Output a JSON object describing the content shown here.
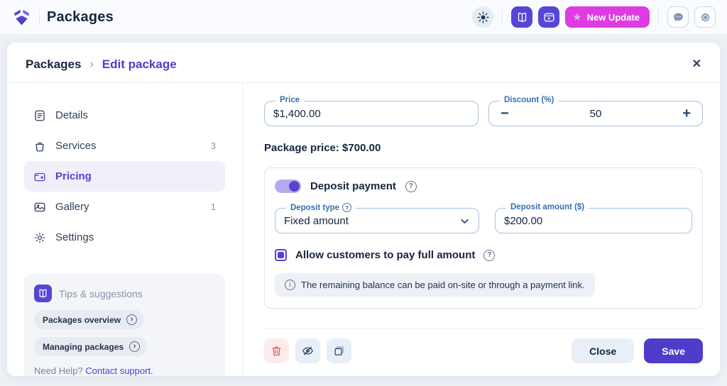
{
  "topbar": {
    "title": "Packages",
    "new_update": "New Update"
  },
  "breadcrumb": {
    "root": "Packages",
    "current": "Edit package"
  },
  "sidebar": {
    "items": [
      {
        "label": "Details",
        "badge": ""
      },
      {
        "label": "Services",
        "badge": "3"
      },
      {
        "label": "Pricing",
        "badge": ""
      },
      {
        "label": "Gallery",
        "badge": "1"
      },
      {
        "label": "Settings",
        "badge": ""
      }
    ],
    "tips": {
      "title": "Tips & suggestions",
      "links": [
        {
          "label": "Packages overview"
        },
        {
          "label": "Managing packages"
        }
      ],
      "help_prefix": "Need Help?",
      "help_link": "Contact support."
    }
  },
  "form": {
    "price": {
      "label": "Price",
      "value": "$1,400.00"
    },
    "discount": {
      "label": "Discount (%)",
      "value": "50"
    },
    "package_price": "Package price: $700.00",
    "deposit": {
      "toggle_label": "Deposit payment",
      "type": {
        "label": "Deposit type",
        "value": "Fixed amount"
      },
      "amount": {
        "label": "Deposit amount ($)",
        "value": "$200.00"
      },
      "checkbox_label": "Allow customers to pay full amount",
      "info": "The remaining balance can be paid on-site or through a payment link."
    }
  },
  "actions": {
    "close": "Close",
    "save": "Save"
  },
  "icons": {
    "minus": "−",
    "plus": "+",
    "question": "?",
    "close_x": "✕",
    "chevron_right": "›",
    "breadcrumb_chevron": "›",
    "info_i": "i",
    "star": "★"
  },
  "colors": {
    "primary": "#5544d4",
    "accent_magenta": "#de3be2",
    "label_blue": "#3470b4",
    "danger": "#e05c66",
    "text_dark": "#17253f",
    "page_bg": "#edf1f6"
  }
}
